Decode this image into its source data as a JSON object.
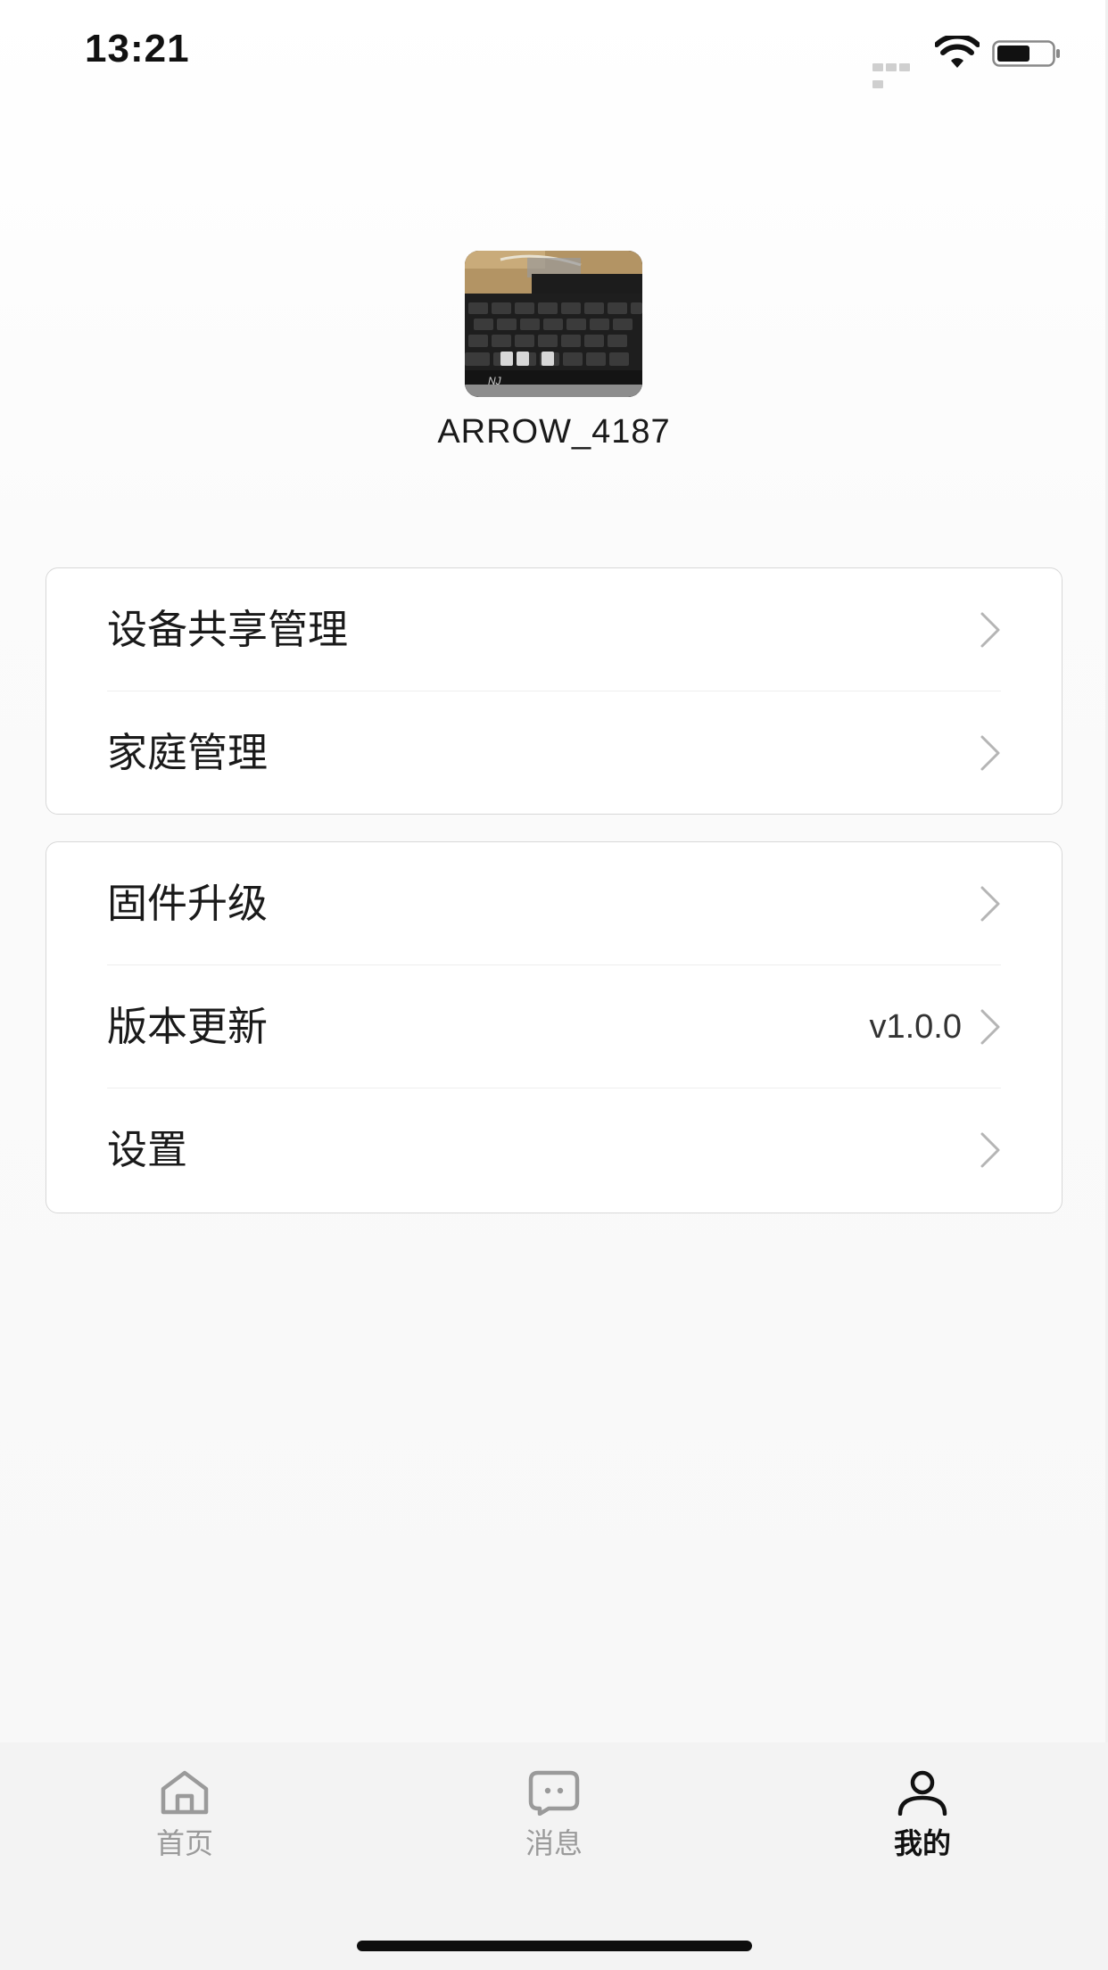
{
  "status_bar": {
    "time": "13:21"
  },
  "profile": {
    "username": "ARROW_4187",
    "avatar_keyboard_brand": "NJ"
  },
  "menu": {
    "group1": [
      {
        "label": "设备共享管理",
        "icon": "chevron-right-icon"
      },
      {
        "label": "家庭管理",
        "icon": "chevron-right-icon"
      }
    ],
    "group2": [
      {
        "label": "固件升级",
        "icon": "chevron-right-icon"
      },
      {
        "label": "版本更新",
        "value": "v1.0.0",
        "icon": "chevron-right-icon"
      },
      {
        "label": "设置",
        "icon": "chevron-right-icon"
      }
    ]
  },
  "tabbar": {
    "items": [
      {
        "label": "首页",
        "icon": "home-icon",
        "active": false
      },
      {
        "label": "消息",
        "icon": "message-icon",
        "active": false
      },
      {
        "label": "我的",
        "icon": "user-icon",
        "active": true
      }
    ]
  },
  "colors": {
    "active_tab": "#111111",
    "inactive_tab": "#9a9a9a",
    "card_border": "#d8d8d8",
    "tabbar_bg": "#f3f3f3"
  }
}
